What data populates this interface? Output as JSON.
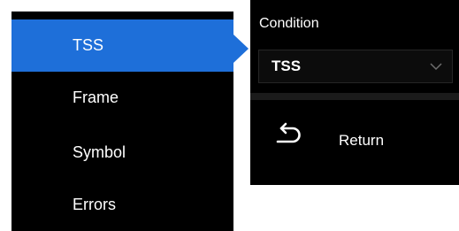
{
  "menu": {
    "items": [
      {
        "label": "TSS",
        "selected": true
      },
      {
        "label": "Frame",
        "selected": false
      },
      {
        "label": "Symbol",
        "selected": false
      },
      {
        "label": "Errors",
        "selected": false
      }
    ]
  },
  "panel": {
    "title": "Condition",
    "select_value": "TSS",
    "return_label": "Return"
  },
  "colors": {
    "accent": "#1e6fd9",
    "background": "#000000"
  },
  "icons": {
    "select": "chevron-down-icon",
    "return": "return-arrow-icon"
  }
}
